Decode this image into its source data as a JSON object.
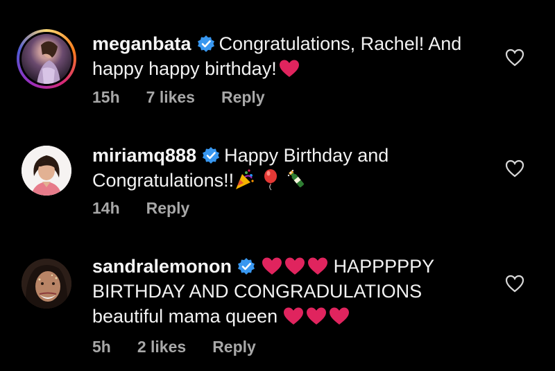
{
  "comments": [
    {
      "username": "meganbata",
      "text_line1": "Congratulations, Rachel! And",
      "text_line2": "happy happy birthday!",
      "time": "15h",
      "likes": "7 likes",
      "reply": "Reply",
      "emojis": [
        "red-heart"
      ],
      "has_story_ring": true
    },
    {
      "username": "miriamq888",
      "text_line1": "Happy Birthday and",
      "text_line2": "Congratulations!!",
      "time": "14h",
      "reply": "Reply",
      "emojis": [
        "party-popper",
        "balloon",
        "champagne"
      ]
    },
    {
      "username": "sandralemonon",
      "text_line1": "HAPPPPPY",
      "text_line2": "BIRTHDAY AND CONGRADULATIONS",
      "text_line3": "beautiful mama queen",
      "time": "5h",
      "likes": "2 likes",
      "reply": "Reply",
      "emojis": [
        "red-heart",
        "red-heart",
        "red-heart",
        "red-heart",
        "red-heart",
        "red-heart"
      ]
    }
  ],
  "colors": {
    "background": "#000000",
    "text": "#f2f2f2",
    "meta": "#a8a8a8",
    "verified": "#3897f0",
    "heart": "#e0245e"
  },
  "icons": {
    "verified": "verified-badge-icon",
    "like": "heart-outline-icon"
  }
}
